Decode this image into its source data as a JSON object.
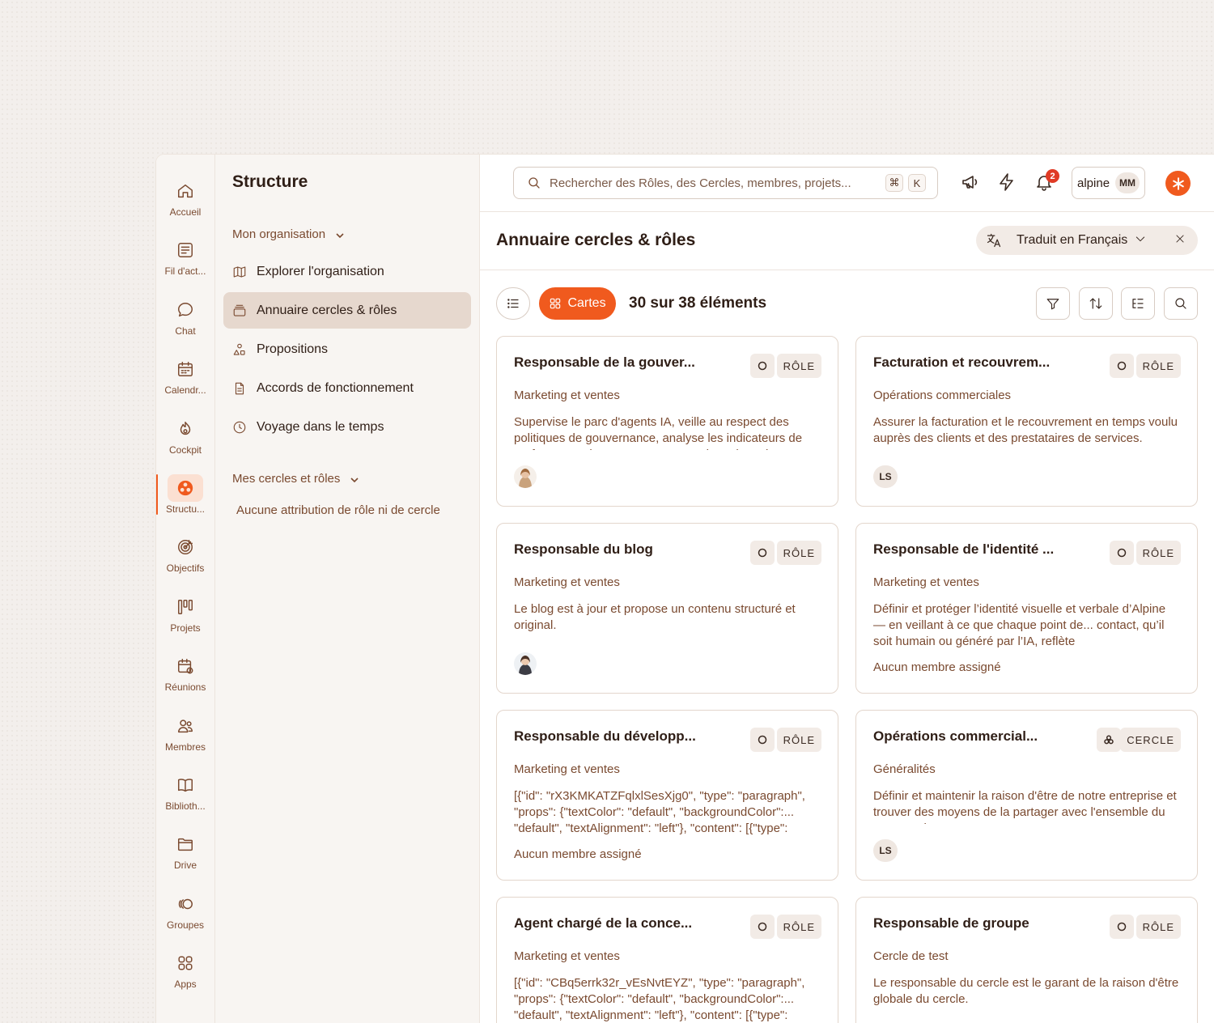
{
  "rail": [
    {
      "label": "Accueil",
      "icon": "home-icon"
    },
    {
      "label": "Fil d'act...",
      "icon": "feed-icon"
    },
    {
      "label": "Chat",
      "icon": "chat-icon"
    },
    {
      "label": "Calendr...",
      "icon": "calendar-icon"
    },
    {
      "label": "Cockpit",
      "icon": "cockpit-icon"
    },
    {
      "label": "Structu...",
      "icon": "structure-icon",
      "active": true
    },
    {
      "label": "Objectifs",
      "icon": "target-icon"
    },
    {
      "label": "Projets",
      "icon": "kanban-icon"
    },
    {
      "label": "Réunions",
      "icon": "meeting-icon"
    },
    {
      "label": "Membres",
      "icon": "members-icon"
    },
    {
      "label": "Biblioth...",
      "icon": "book-icon"
    },
    {
      "label": "Drive",
      "icon": "folder-icon"
    },
    {
      "label": "Groupes",
      "icon": "groups-icon"
    },
    {
      "label": "Apps",
      "icon": "apps-icon"
    }
  ],
  "panel": {
    "title": "Structure",
    "org_section": "Mon organisation",
    "items": [
      {
        "label": "Explorer l'organisation"
      },
      {
        "label": "Annuaire cercles & rôles"
      },
      {
        "label": "Propositions"
      },
      {
        "label": "Accords de fonctionnement"
      },
      {
        "label": "Voyage dans le temps"
      }
    ],
    "my_section": "Mes cercles et rôles",
    "empty_note": "Aucune attribution de rôle ni de cercle"
  },
  "topbar": {
    "search_placeholder": "Rechercher des Rôles, des Cercles, membres, projets...",
    "kbd1": "⌘",
    "kbd2": "K",
    "notifications": "2",
    "account": "alpine",
    "account_initials": "MM"
  },
  "page": {
    "title": "Annuaire cercles & rôles",
    "translate": "Traduit en Français",
    "cards_btn": "Cartes",
    "count": "30 sur 38 éléments"
  },
  "cards": [
    {
      "title": "Responsable de la gouver...",
      "tag": "RÔLE",
      "circle": "Marketing et ventes",
      "desc": "Supervise le parc d'agents IA, veille au respect des politiques de gouvernance, analyse les indicateurs de performance des agents ; propose des adaptations en",
      "foot": "photo"
    },
    {
      "title": "Facturation et recouvrem...",
      "tag": "RÔLE",
      "circle": "Opérations commerciales",
      "desc": "Assurer la facturation et le recouvrement en temps voulu auprès des clients et des prestataires de services.",
      "foot": "LS"
    },
    {
      "title": "Responsable du blog",
      "tag": "RÔLE",
      "circle": "Marketing et ventes",
      "desc": "Le blog est à jour et propose un contenu structuré et original.",
      "foot": "photo"
    },
    {
      "title": "Responsable de l'identité ...",
      "tag": "RÔLE",
      "circle": "Marketing et ventes",
      "desc": "Définir et protéger l’identité visuelle et verbale d’Alpine — en veillant à ce que chaque point de... contact, qu’il soit humain ou généré par l’IA, reflète",
      "foot_text": "Aucun membre assigné"
    },
    {
      "title": "Responsable du développ...",
      "tag": "RÔLE",
      "circle": "Marketing et ventes",
      "desc": "[{\"id\": \"rX3KMKATZFqlxlSesXjg0\", \"type\": \"paragraph\", \"props\": {\"textColor\": \"default\", \"backgroundColor\":... \"default\", \"textAlignment\": \"left\"}, \"content\": [{\"type\":",
      "foot_text": "Aucun membre assigné"
    },
    {
      "title": "Opérations commercial...",
      "tag": "CERCLE",
      "circle": "Généralités",
      "desc": "Définir et maintenir la raison d'être de notre entreprise et trouver des moyens de la partager avec l'ensemble du personnel",
      "foot": "LS"
    },
    {
      "title": "Agent chargé de la conce...",
      "tag": "RÔLE",
      "circle": "Marketing et ventes",
      "desc": "[{\"id\": \"CBq5errk32r_vEsNvtEYZ\", \"type\": \"paragraph\", \"props\": {\"textColor\": \"default\", \"backgroundColor\":... \"default\", \"textAlignment\": \"left\"}, \"content\": [{\"type\":"
    },
    {
      "title": "Responsable de groupe",
      "tag": "RÔLE",
      "circle": "Cercle de test",
      "desc": "Le responsable du cercle est le garant de la raison d'être globale du cercle."
    }
  ],
  "colors": {
    "accent": "#f05a1e",
    "badge": "#e03b25"
  }
}
